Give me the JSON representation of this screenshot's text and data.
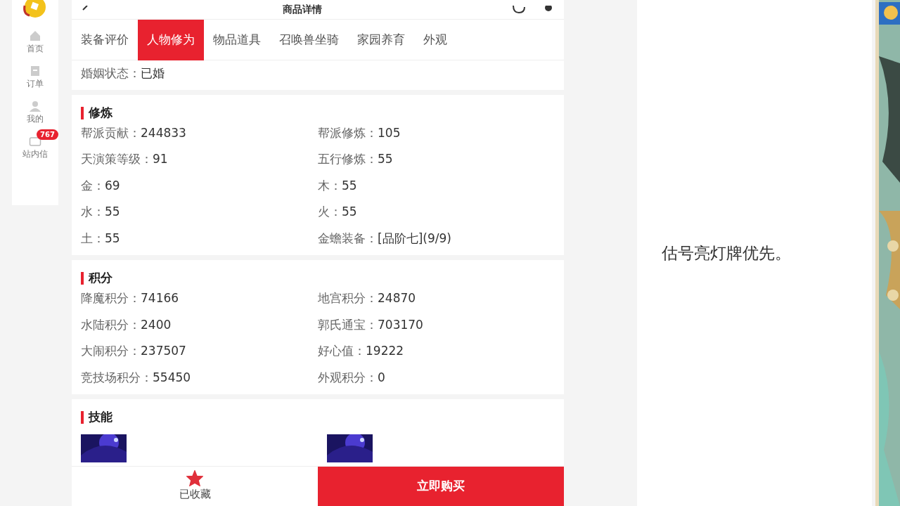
{
  "sidebar": {
    "items": [
      {
        "label": "首页",
        "kind": "home"
      },
      {
        "label": "订单",
        "kind": "doc"
      },
      {
        "label": "我的",
        "kind": "user"
      },
      {
        "label": "站内信",
        "kind": "mail",
        "badge": "767"
      }
    ]
  },
  "header": {
    "title": "商品详情"
  },
  "tabs": [
    {
      "label": "装备评价",
      "selected": false
    },
    {
      "label": "人物修为",
      "selected": true
    },
    {
      "label": "物品道具",
      "selected": false
    },
    {
      "label": "召唤兽坐骑",
      "selected": false
    },
    {
      "label": "家园养育",
      "selected": false
    },
    {
      "label": "外观",
      "selected": false
    }
  ],
  "top_fields": [
    {
      "label": "婚姻状态：",
      "value": "已婚"
    }
  ],
  "sections": [
    {
      "title": "修炼",
      "fields": [
        {
          "label": "帮派贡献：",
          "value": "244833"
        },
        {
          "label": "帮派修炼：",
          "value": "105"
        },
        {
          "label": "天演策等级：",
          "value": "91"
        },
        {
          "label": "五行修炼：",
          "value": "55"
        },
        {
          "label": "金：",
          "value": "69"
        },
        {
          "label": "木：",
          "value": "55"
        },
        {
          "label": "水：",
          "value": "55"
        },
        {
          "label": "火：",
          "value": "55"
        },
        {
          "label": "土：",
          "value": "55"
        },
        {
          "label": "金蟾装备：",
          "value": "[品阶七](9/9)"
        }
      ]
    },
    {
      "title": "积分",
      "fields": [
        {
          "label": "降魔积分：",
          "value": "74166"
        },
        {
          "label": "地宫积分：",
          "value": "24870"
        },
        {
          "label": "水陆积分：",
          "value": "2400"
        },
        {
          "label": "郭氏通宝：",
          "value": "703170"
        },
        {
          "label": "大闹积分：",
          "value": "237507"
        },
        {
          "label": "好心值：",
          "value": "19222"
        },
        {
          "label": "竞技场积分：",
          "value": "55450"
        },
        {
          "label": "外观积分：",
          "value": "0"
        }
      ]
    },
    {
      "title": "技能"
    }
  ],
  "bottom_bar": {
    "favorite": {
      "label": "已收藏",
      "on": true
    },
    "buy": "立即购买"
  },
  "note": "估号亮灯牌优先。"
}
